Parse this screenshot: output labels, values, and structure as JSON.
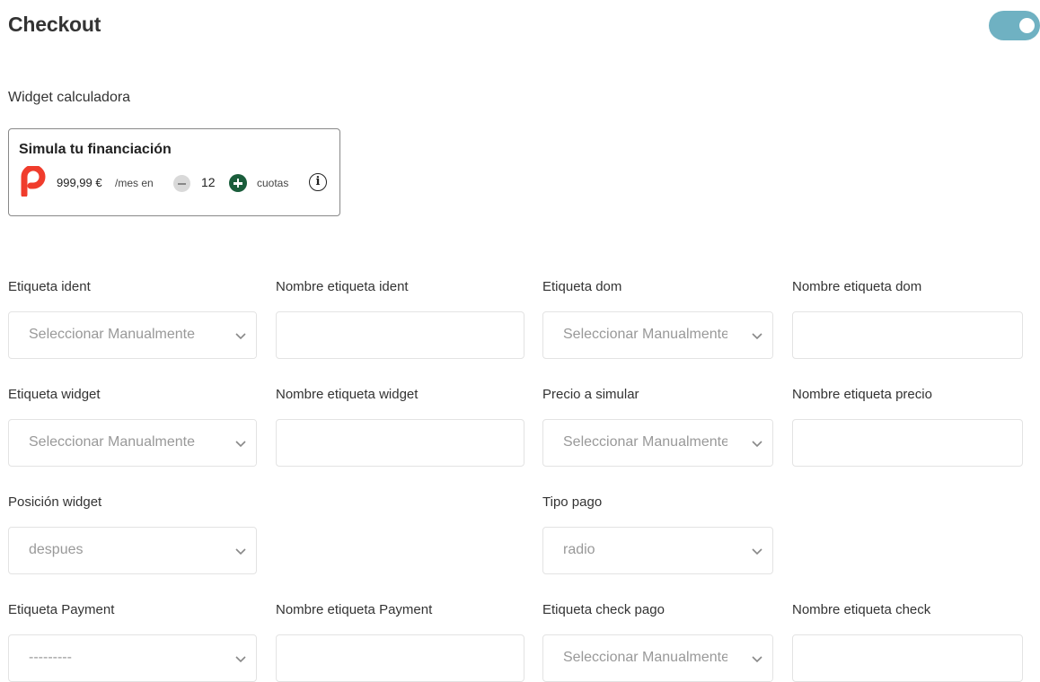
{
  "header": {
    "title": "Checkout",
    "toggle_on": true,
    "accent": "#6fb1c2"
  },
  "widget_section": {
    "label": "Widget calculadora",
    "card": {
      "title": "Simula tu financiación",
      "logo_icon": "pagantis-p-logo",
      "amount": "999,99 €",
      "per_month": "/mes en",
      "installments": "12",
      "installments_label": "cuotas",
      "info_glyph": "i",
      "logo_color": "#f03c2c",
      "plus_color": "#1a5d3b"
    }
  },
  "form": {
    "etiqueta_ident": {
      "label": "Etiqueta ident",
      "value": "Seleccionar Manualmente"
    },
    "nombre_etiqueta_ident": {
      "label": "Nombre etiqueta ident",
      "value": ""
    },
    "etiqueta_dom": {
      "label": "Etiqueta dom",
      "value": "Seleccionar Manualmente"
    },
    "nombre_etiqueta_dom": {
      "label": "Nombre etiqueta dom",
      "value": ""
    },
    "etiqueta_widget": {
      "label": "Etiqueta widget",
      "value": "Seleccionar Manualmente"
    },
    "nombre_etiqueta_widget": {
      "label": "Nombre etiqueta widget",
      "value": ""
    },
    "precio_a_simular": {
      "label": "Precio a simular",
      "value": "Seleccionar Manualmente"
    },
    "nombre_etiqueta_precio": {
      "label": "Nombre etiqueta precio",
      "value": ""
    },
    "posicion_widget": {
      "label": "Posición widget",
      "value": "despues"
    },
    "tipo_pago": {
      "label": "Tipo pago",
      "value": "radio"
    },
    "etiqueta_payment": {
      "label": "Etiqueta Payment",
      "value": "---------"
    },
    "nombre_etiqueta_payment": {
      "label": "Nombre etiqueta Payment",
      "value": ""
    },
    "etiqueta_check_pago": {
      "label": "Etiqueta check pago",
      "value": "Seleccionar Manualmente"
    },
    "nombre_etiqueta_check": {
      "label": "Nombre etiqueta check",
      "value": ""
    }
  }
}
